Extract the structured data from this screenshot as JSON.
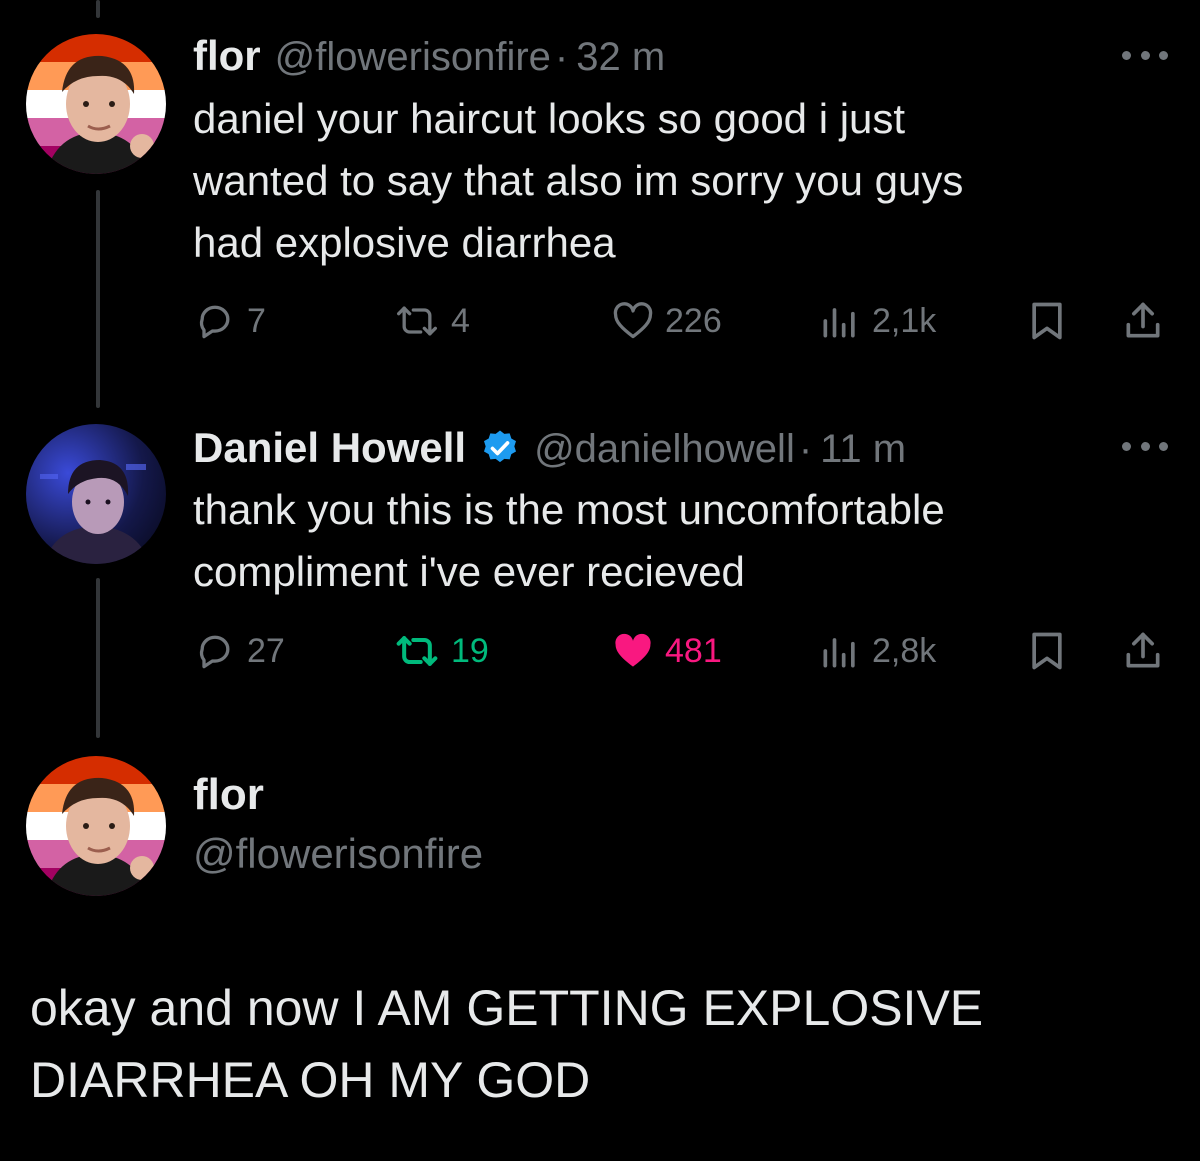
{
  "thread": [
    {
      "author": {
        "name": "flor",
        "handle": "@flowerisonfire",
        "verified": false
      },
      "timestamp": "32 m",
      "text_lines": [
        "daniel your haircut looks so good i just",
        "wanted to say that also im sorry you guys",
        "had explosive diarrhea"
      ],
      "stats": {
        "replies": "7",
        "reposts": "4",
        "likes": "226",
        "views": "2,1k"
      },
      "reposted": false,
      "liked": false
    },
    {
      "author": {
        "name": "Daniel Howell",
        "handle": "@danielhowell",
        "verified": true
      },
      "timestamp": "11 m",
      "text_lines": [
        "thank you this is the most uncomfortable",
        "compliment i've ever recieved"
      ],
      "stats": {
        "replies": "27",
        "reposts": "19",
        "likes": "481",
        "views": "2,8k"
      },
      "reposted": true,
      "liked": true
    }
  ],
  "main_post": {
    "author": {
      "name": "flor",
      "handle": "@flowerisonfire"
    },
    "text_lines": [
      "okay and now I AM GETTING EXPLOSIVE",
      "DIARRHEA OH MY GOD"
    ]
  },
  "separator": "·",
  "icons": [
    "reply-icon",
    "repost-icon",
    "like-icon",
    "views-icon",
    "bookmark-icon",
    "share-icon",
    "more-icon",
    "verified-badge-icon"
  ],
  "colors": {
    "background": "#000000",
    "text": "#e7e9ea",
    "muted": "#71767b",
    "repost_active": "#00ba7c",
    "like_active": "#f91880",
    "verified": "#1d9bf0",
    "thread_line": "#333639"
  }
}
